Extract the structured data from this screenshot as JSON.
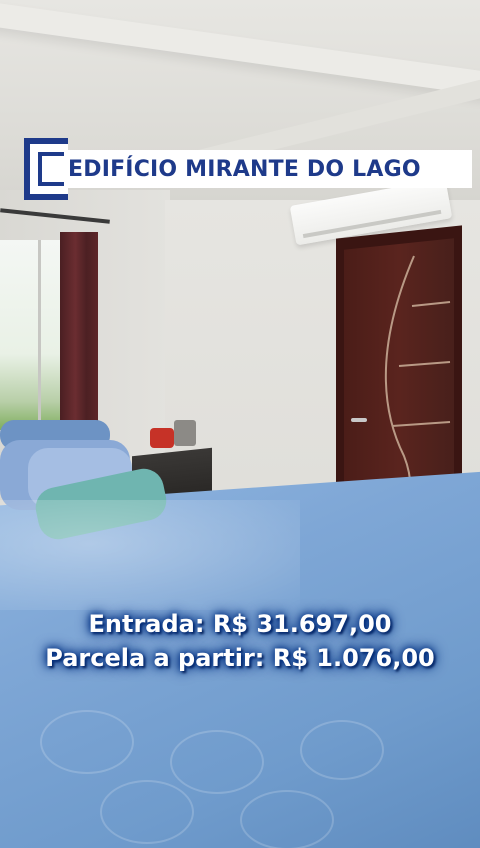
{
  "banner": {
    "title": "EDIFÍCIO MIRANTE DO LAGO",
    "color": "#1e3a8a"
  },
  "pricing": {
    "entrada": "Entrada: R$ 31.697,00",
    "parcela": "Parcela a partir: R$ 1.076,00"
  },
  "icons": {
    "bracket": "bracket-logo-icon"
  }
}
